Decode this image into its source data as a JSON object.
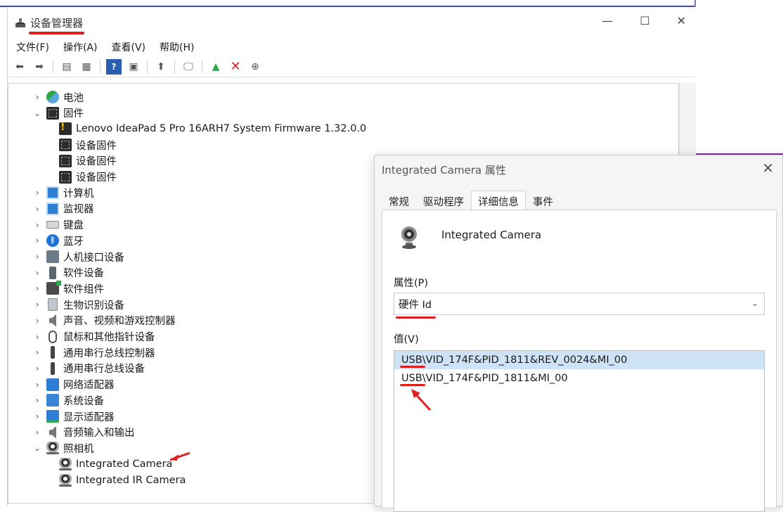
{
  "window": {
    "title": "设备管理器",
    "menu": [
      "文件(F)",
      "操作(A)",
      "查看(V)",
      "帮助(H)"
    ]
  },
  "tree": {
    "items": [
      {
        "label": "电池",
        "chevron": ">",
        "icon": "battery-icon"
      },
      {
        "label": "固件",
        "chevron": "v",
        "icon": "firmware-icon"
      },
      {
        "label": "Lenovo IdeaPad 5 Pro 16ARH7 System Firmware 1.32.0.0",
        "chevron": "",
        "icon": "firmware-warning-icon"
      },
      {
        "label": "设备固件",
        "chevron": "",
        "icon": "firmware-icon"
      },
      {
        "label": "设备固件",
        "chevron": "",
        "icon": "firmware-icon"
      },
      {
        "label": "设备固件",
        "chevron": "",
        "icon": "firmware-icon"
      },
      {
        "label": "计算机",
        "chevron": ">",
        "icon": "computer-icon"
      },
      {
        "label": "监视器",
        "chevron": ">",
        "icon": "monitor-icon"
      },
      {
        "label": "键盘",
        "chevron": ">",
        "icon": "keyboard-icon"
      },
      {
        "label": "蓝牙",
        "chevron": ">",
        "icon": "bluetooth-icon"
      },
      {
        "label": "人机接口设备",
        "chevron": ">",
        "icon": "hid-icon"
      },
      {
        "label": "软件设备",
        "chevron": ">",
        "icon": "software-device-icon"
      },
      {
        "label": "软件组件",
        "chevron": ">",
        "icon": "software-component-icon"
      },
      {
        "label": "生物识别设备",
        "chevron": ">",
        "icon": "biometric-icon"
      },
      {
        "label": "声音、视频和游戏控制器",
        "chevron": ">",
        "icon": "sound-icon"
      },
      {
        "label": "鼠标和其他指针设备",
        "chevron": ">",
        "icon": "mouse-icon"
      },
      {
        "label": "通用串行总线控制器",
        "chevron": ">",
        "icon": "usb-icon"
      },
      {
        "label": "通用串行总线设备",
        "chevron": ">",
        "icon": "usb-icon"
      },
      {
        "label": "网络适配器",
        "chevron": ">",
        "icon": "network-icon"
      },
      {
        "label": "系统设备",
        "chevron": ">",
        "icon": "system-device-icon"
      },
      {
        "label": "显示适配器",
        "chevron": ">",
        "icon": "display-adapter-icon"
      },
      {
        "label": "音频输入和输出",
        "chevron": ">",
        "icon": "audio-io-icon"
      },
      {
        "label": "照相机",
        "chevron": "v",
        "icon": "camera-icon"
      },
      {
        "label": "Integrated Camera",
        "chevron": "",
        "icon": "camera-icon"
      },
      {
        "label": "Integrated IR Camera",
        "chevron": "",
        "icon": "camera-icon"
      }
    ]
  },
  "dialog": {
    "title": "Integrated Camera 属性",
    "tabs": [
      "常规",
      "驱动程序",
      "详细信息",
      "事件"
    ],
    "active_tab": "详细信息",
    "device_name": "Integrated Camera",
    "property_label": "属性(P)",
    "property_value": "硬件 Id",
    "value_label": "值(V)",
    "values": [
      "USB\\VID_174F&PID_1811&REV_0024&MI_00",
      "USB\\VID_174F&PID_1811&MI_00"
    ]
  },
  "colors": {
    "annotation": "#e01e1e",
    "selection": "#cfe3f7"
  }
}
